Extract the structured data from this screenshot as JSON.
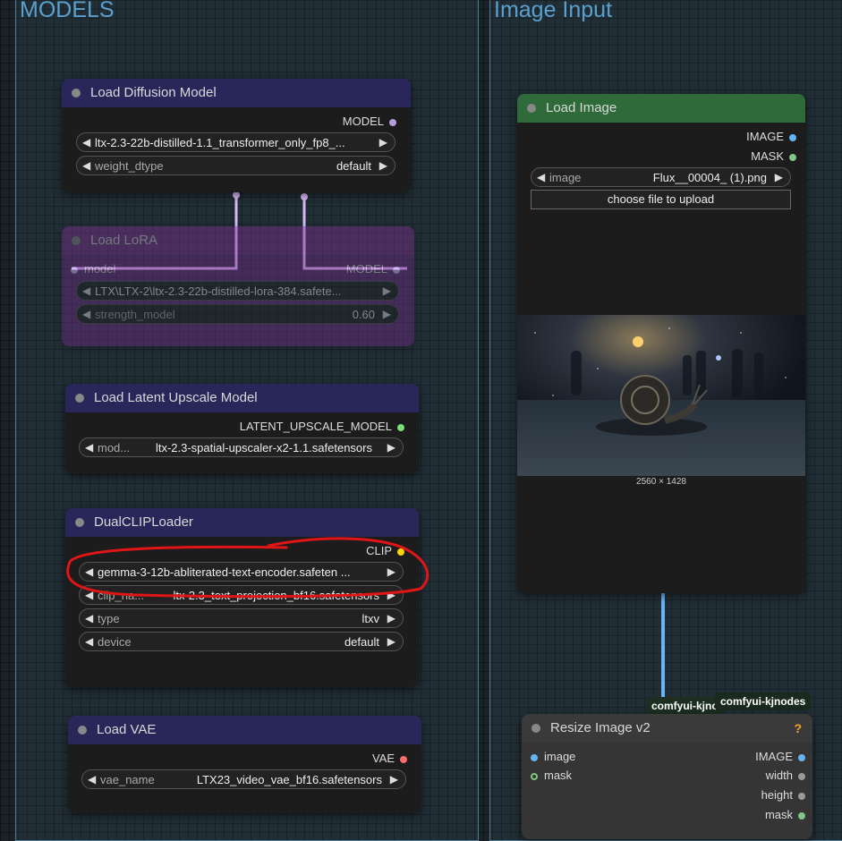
{
  "groups": {
    "models": {
      "title": "MODELS"
    },
    "image_input": {
      "title": "Image Input"
    }
  },
  "load_diffusion_model": {
    "title": "Load Diffusion Model",
    "output": "MODEL",
    "unet_name": "ltx-2.3-22b-distilled-1.1_transformer_only_fp8_...",
    "weight_dtype_label": "weight_dtype",
    "weight_dtype_value": "default"
  },
  "load_lora": {
    "title": "Load LoRA",
    "input": "model",
    "output": "MODEL",
    "lora_name": "LTX\\LTX-2\\ltx-2.3-22b-distilled-lora-384.safete...",
    "strength_label": "strength_model",
    "strength_value": "0.60"
  },
  "load_latent_upscale": {
    "title": "Load Latent Upscale Model",
    "output": "LATENT_UPSCALE_MODEL",
    "model_label": "mod...",
    "model_value": "ltx-2.3-spatial-upscaler-x2-1.1.safetensors"
  },
  "dual_clip_loader": {
    "title": "DualCLIPLoader",
    "output": "CLIP",
    "clip_name1": "gemma-3-12b-abliterated-text-encoder.safeten ...",
    "clip_name2_label": "clip_na...",
    "clip_name2_value": "ltx-2.3_text_projection_bf16.safetensors",
    "type_label": "type",
    "type_value": "ltxv",
    "device_label": "device",
    "device_value": "default"
  },
  "load_vae": {
    "title": "Load VAE",
    "output": "VAE",
    "vae_label": "vae_name",
    "vae_value": "LTX23_video_vae_bf16.safetensors"
  },
  "load_image": {
    "title": "Load Image",
    "outputs": [
      "IMAGE",
      "MASK"
    ],
    "image_label": "image",
    "image_value": "Flux__00004_ (1).png",
    "upload_label": "choose file to upload",
    "dimensions": "2560 × 1428"
  },
  "tags": {
    "tag1": "comfyui-kjno",
    "tag2": "comfyui-kjnodes"
  },
  "resize_image": {
    "title": "Resize Image v2",
    "help": "?",
    "inputs": [
      "image",
      "mask"
    ],
    "outputs": [
      "IMAGE",
      "width",
      "height",
      "mask"
    ]
  },
  "colors": {
    "model": "#b39ddb",
    "image": "#64b5f6",
    "mask": "#81c784",
    "latent_upscale": "#7dde7d",
    "clip": "#ffd500",
    "vae": "#ff6b6b",
    "annotation": "#e01515"
  }
}
